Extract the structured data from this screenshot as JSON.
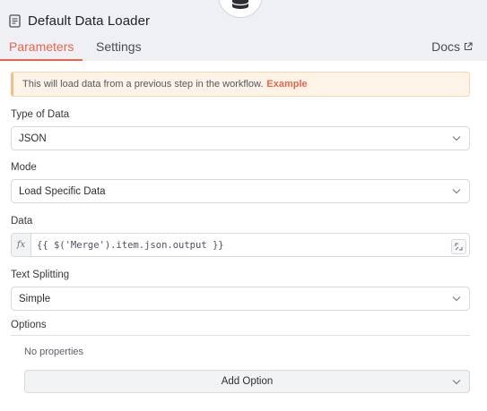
{
  "header": {
    "title": "Default Data Loader",
    "node_icon": "database-icon",
    "title_icon": "document-icon"
  },
  "tabs": [
    {
      "label": "Parameters",
      "active": true
    },
    {
      "label": "Settings",
      "active": false
    }
  ],
  "docs": {
    "label": "Docs",
    "icon": "external-link-icon"
  },
  "notice": {
    "text": "This will load data from a previous step in the workflow.",
    "link": "Example"
  },
  "fields": {
    "type_of_data": {
      "label": "Type of Data",
      "value": "JSON"
    },
    "mode": {
      "label": "Mode",
      "value": "Load Specific Data"
    },
    "data": {
      "label": "Data",
      "fx": "fx",
      "value": "{{ $('Merge').item.json.output }}"
    },
    "text_splitting": {
      "label": "Text Splitting",
      "value": "Simple"
    }
  },
  "options": {
    "label": "Options",
    "empty_text": "No properties",
    "add_button": "Add Option"
  },
  "colors": {
    "accent": "#e9644b",
    "header_bg": "#eef0f4",
    "notice_bg": "#fdf3e7"
  }
}
